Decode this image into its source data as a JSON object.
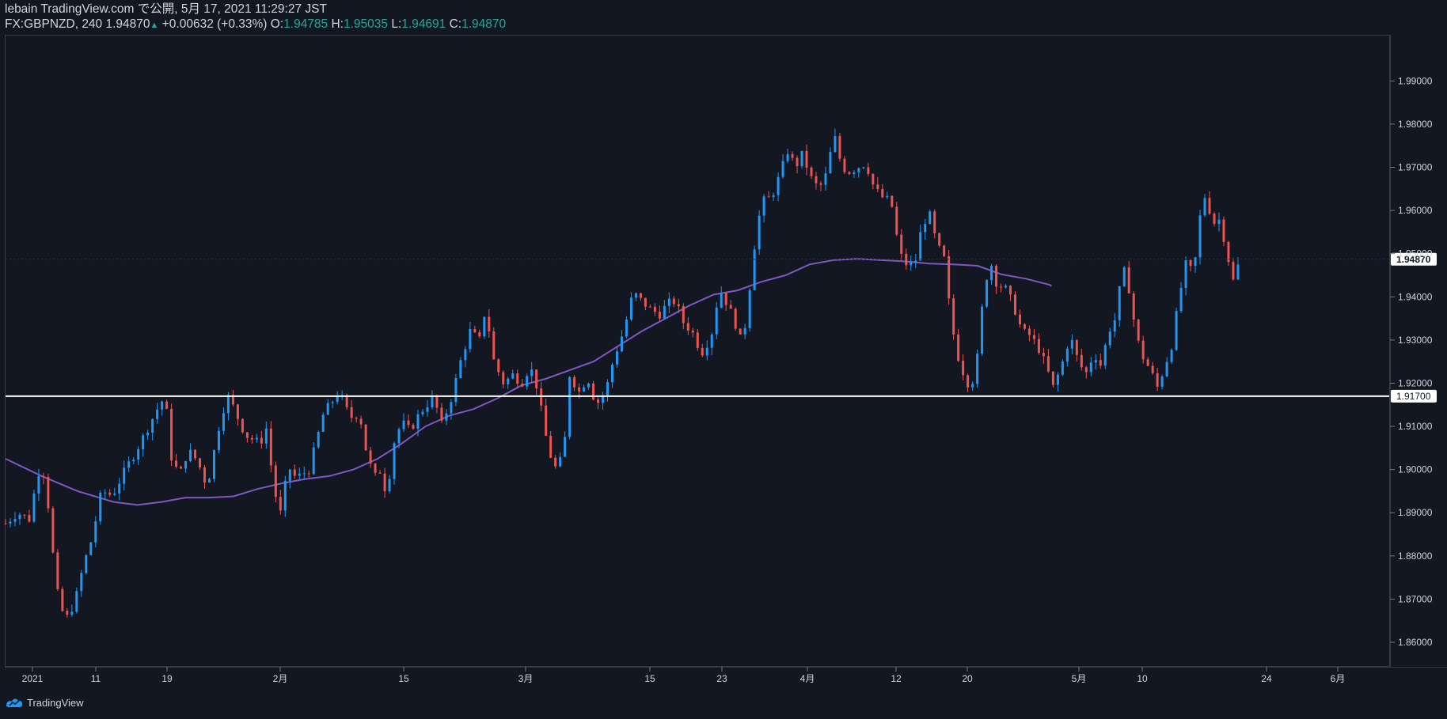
{
  "header": {
    "publish_line": "lebain TradingView.com で公開, 5月 17, 2021 11:29:27 JST",
    "symbol": "FX:GBPNZD, 240",
    "last": "1.94870",
    "arrow": "▲",
    "change": "+0.00632 (+0.33%)",
    "o_label": "O:",
    "o_value": "1.94785",
    "h_label": "H:",
    "h_value": "1.95035",
    "l_label": "L:",
    "l_value": "1.94691",
    "c_label": "C:",
    "c_value": "1.94870"
  },
  "footer": {
    "brand": "TradingView"
  },
  "colors": {
    "background": "#131722",
    "up": "#2196f3",
    "down": "#ef5350",
    "ma": "#7e57c2",
    "hline": "#ffffff",
    "text": "#d1d4dc",
    "ohlc_value": "#26a69a"
  },
  "chart_data": {
    "type": "candlestick",
    "instrument": "FX:GBPNZD",
    "timeframe": "240",
    "y_ticks": [
      "1.86000",
      "1.87000",
      "1.88000",
      "1.89000",
      "1.90000",
      "1.91000",
      "1.92000",
      "1.93000",
      "1.94000",
      "1.95000",
      "1.96000",
      "1.97000",
      "1.98000",
      "1.99000"
    ],
    "y_range": [
      1.8545,
      2.0005
    ],
    "x_ticks": [
      "2021",
      "11",
      "19",
      "2月",
      "15",
      "3月",
      "15",
      "23",
      "4月",
      "12",
      "20",
      "5月",
      "10",
      "24",
      "6月"
    ],
    "last_price_label": "1.94870",
    "horizontal_line": {
      "value": 1.917,
      "label": "1.91700"
    },
    "moving_average": [
      [
        0,
        1.9025
      ],
      [
        0.03,
        1.8985
      ],
      [
        0.06,
        1.895
      ],
      [
        0.09,
        1.8925
      ],
      [
        0.11,
        1.8918
      ],
      [
        0.13,
        1.8925
      ],
      [
        0.15,
        1.8935
      ],
      [
        0.17,
        1.8935
      ],
      [
        0.19,
        1.8938
      ],
      [
        0.21,
        1.8955
      ],
      [
        0.23,
        1.8968
      ],
      [
        0.25,
        1.8978
      ],
      [
        0.27,
        1.8985
      ],
      [
        0.29,
        1.9
      ],
      [
        0.31,
        1.9025
      ],
      [
        0.33,
        1.906
      ],
      [
        0.35,
        1.91
      ],
      [
        0.37,
        1.9125
      ],
      [
        0.39,
        1.914
      ],
      [
        0.41,
        1.9165
      ],
      [
        0.43,
        1.9195
      ],
      [
        0.45,
        1.921
      ],
      [
        0.47,
        1.923
      ],
      [
        0.49,
        1.925
      ],
      [
        0.51,
        1.9285
      ],
      [
        0.53,
        1.932
      ],
      [
        0.55,
        1.935
      ],
      [
        0.57,
        1.938
      ],
      [
        0.59,
        1.9405
      ],
      [
        0.61,
        1.9415
      ],
      [
        0.63,
        1.9435
      ],
      [
        0.65,
        1.945
      ],
      [
        0.67,
        1.9475
      ],
      [
        0.69,
        1.9485
      ],
      [
        0.71,
        1.9488
      ],
      [
        0.73,
        1.9485
      ],
      [
        0.75,
        1.9482
      ],
      [
        0.77,
        1.9477
      ],
      [
        0.79,
        1.9475
      ],
      [
        0.81,
        1.9472
      ],
      [
        0.83,
        1.9452
      ],
      [
        0.85,
        1.9442
      ],
      [
        0.87,
        1.9428
      ],
      [
        0.8717,
        1.9425
      ]
    ],
    "close_path": [
      [
        0.0,
        1.8875
      ],
      [
        0.01,
        1.89
      ],
      [
        0.02,
        1.8885
      ],
      [
        0.027,
        1.8995
      ],
      [
        0.033,
        1.899
      ],
      [
        0.04,
        1.879
      ],
      [
        0.044,
        1.87
      ],
      [
        0.05,
        1.865
      ],
      [
        0.058,
        1.8695
      ],
      [
        0.065,
        1.878
      ],
      [
        0.072,
        1.884
      ],
      [
        0.08,
        1.895
      ],
      [
        0.089,
        1.894
      ],
      [
        0.098,
        1.899
      ],
      [
        0.112,
        1.906
      ],
      [
        0.13,
        1.916
      ],
      [
        0.134,
        1.914
      ],
      [
        0.138,
        1.903
      ],
      [
        0.145,
        1.8985
      ],
      [
        0.152,
        1.9045
      ],
      [
        0.16,
        1.902
      ],
      [
        0.168,
        1.896
      ],
      [
        0.18,
        1.913
      ],
      [
        0.186,
        1.917
      ],
      [
        0.192,
        1.913
      ],
      [
        0.2,
        1.908
      ],
      [
        0.212,
        1.906
      ],
      [
        0.218,
        1.91
      ],
      [
        0.223,
        1.896
      ],
      [
        0.23,
        1.889
      ],
      [
        0.235,
        1.901
      ],
      [
        0.242,
        1.898
      ],
      [
        0.253,
        1.9
      ],
      [
        0.265,
        1.913
      ],
      [
        0.278,
        1.918
      ],
      [
        0.287,
        1.912
      ],
      [
        0.295,
        1.913
      ],
      [
        0.3,
        1.905
      ],
      [
        0.307,
        1.898
      ],
      [
        0.313,
        1.9
      ],
      [
        0.318,
        1.893
      ],
      [
        0.322,
        1.905
      ],
      [
        0.33,
        1.911
      ],
      [
        0.337,
        1.909
      ],
      [
        0.345,
        1.913
      ],
      [
        0.357,
        1.917
      ],
      [
        0.363,
        1.91
      ],
      [
        0.372,
        1.917
      ],
      [
        0.38,
        1.926
      ],
      [
        0.387,
        1.932
      ],
      [
        0.395,
        1.93
      ],
      [
        0.4,
        1.9375
      ],
      [
        0.407,
        1.925
      ],
      [
        0.415,
        1.92
      ],
      [
        0.423,
        1.922
      ],
      [
        0.43,
        1.92
      ],
      [
        0.437,
        1.924
      ],
      [
        0.443,
        1.919
      ],
      [
        0.45,
        1.908
      ],
      [
        0.457,
        1.9
      ],
      [
        0.465,
        1.903
      ],
      [
        0.47,
        1.922
      ],
      [
        0.478,
        1.918
      ],
      [
        0.485,
        1.9215
      ],
      [
        0.492,
        1.915
      ],
      [
        0.5,
        1.918
      ],
      [
        0.507,
        1.926
      ],
      [
        0.515,
        1.932
      ],
      [
        0.523,
        1.941
      ],
      [
        0.53,
        1.939
      ],
      [
        0.538,
        1.937
      ],
      [
        0.545,
        1.936
      ],
      [
        0.552,
        1.9385
      ],
      [
        0.558,
        1.939
      ],
      [
        0.565,
        1.934
      ],
      [
        0.572,
        1.932
      ],
      [
        0.58,
        1.927
      ],
      [
        0.588,
        1.931
      ],
      [
        0.595,
        1.942
      ],
      [
        0.602,
        1.938
      ],
      [
        0.608,
        1.934
      ],
      [
        0.612,
        1.93
      ],
      [
        0.617,
        1.934
      ],
      [
        0.623,
        1.95
      ],
      [
        0.63,
        1.962
      ],
      [
        0.638,
        1.963
      ],
      [
        0.645,
        1.968
      ],
      [
        0.652,
        1.974
      ],
      [
        0.658,
        1.97
      ],
      [
        0.664,
        1.973
      ],
      [
        0.672,
        1.967
      ],
      [
        0.678,
        1.965
      ],
      [
        0.685,
        1.969
      ],
      [
        0.69,
        1.978
      ],
      [
        0.697,
        1.97
      ],
      [
        0.703,
        1.969
      ],
      [
        0.71,
        1.97
      ],
      [
        0.717,
        1.971
      ],
      [
        0.724,
        1.965
      ],
      [
        0.731,
        1.963
      ],
      [
        0.738,
        1.962
      ],
      [
        0.745,
        1.95
      ],
      [
        0.752,
        1.947
      ],
      [
        0.758,
        1.948
      ],
      [
        0.764,
        1.957
      ],
      [
        0.77,
        1.959
      ],
      [
        0.776,
        1.952
      ],
      [
        0.782,
        1.949
      ],
      [
        0.788,
        1.934
      ],
      [
        0.794,
        1.926
      ],
      [
        0.801,
        1.92
      ],
      [
        0.808,
        1.921
      ],
      [
        0.814,
        1.938
      ],
      [
        0.82,
        1.949
      ],
      [
        0.826,
        1.943
      ],
      [
        0.833,
        1.942
      ],
      [
        0.84,
        1.938
      ],
      [
        0.847,
        1.932
      ],
      [
        0.854,
        1.931
      ],
      [
        0.861,
        1.928
      ],
      [
        0.867,
        1.924
      ],
      [
        0.873,
        1.919
      ],
      [
        0.88,
        1.924
      ],
      [
        0.887,
        1.931
      ],
      [
        0.894,
        1.925
      ],
      [
        0.9,
        1.922
      ],
      [
        0.907,
        1.927
      ],
      [
        0.913,
        1.924
      ],
      [
        0.919,
        1.932
      ],
      [
        0.925,
        1.935
      ],
      [
        0.931,
        1.947
      ],
      [
        0.937,
        1.941
      ],
      [
        0.942,
        1.931
      ],
      [
        0.948,
        1.926
      ],
      [
        0.954,
        1.923
      ],
      [
        0.96,
        1.919
      ],
      [
        0.966,
        1.924
      ],
      [
        0.972,
        1.929
      ],
      [
        0.978,
        1.94
      ],
      [
        0.984,
        1.948
      ],
      [
        0.99,
        1.945
      ],
      [
        0.995,
        1.958
      ],
      [
        1.0,
        1.964
      ],
      [
        1.006,
        1.957
      ],
      [
        1.012,
        1.958
      ],
      [
        1.018,
        1.95
      ],
      [
        1.024,
        1.9425
      ],
      [
        1.028,
        1.9487
      ]
    ]
  }
}
